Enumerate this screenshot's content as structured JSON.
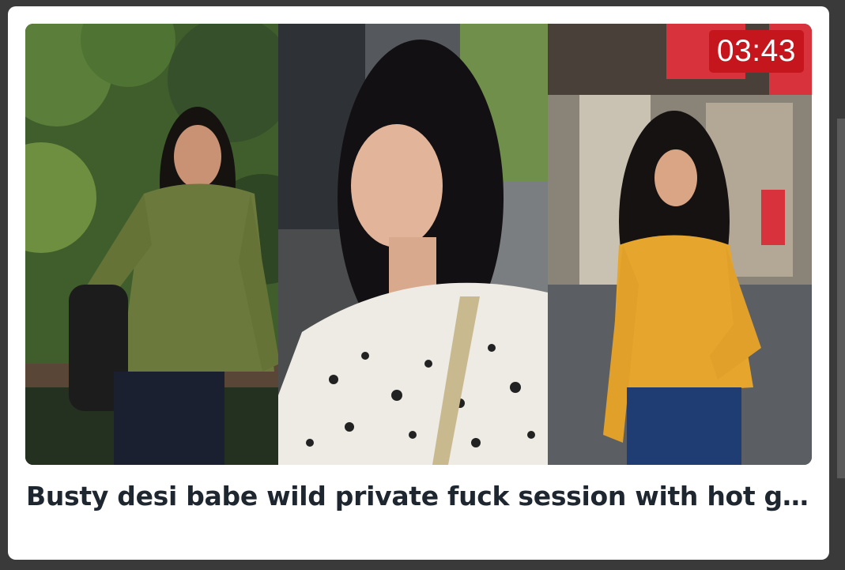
{
  "video": {
    "duration": "03:43",
    "title": "Busty desi babe wild private fuck session with hot girl…",
    "thumbnail_panels": [
      "photo-outdoor-olive-shirt",
      "photo-selfie-animal-print-top",
      "photo-street-yellow-blouse"
    ]
  },
  "colors": {
    "duration_badge": "#c4161c",
    "title_text": "#1e2630",
    "card_background": "#ffffff",
    "page_background": "#3a3a3a"
  }
}
